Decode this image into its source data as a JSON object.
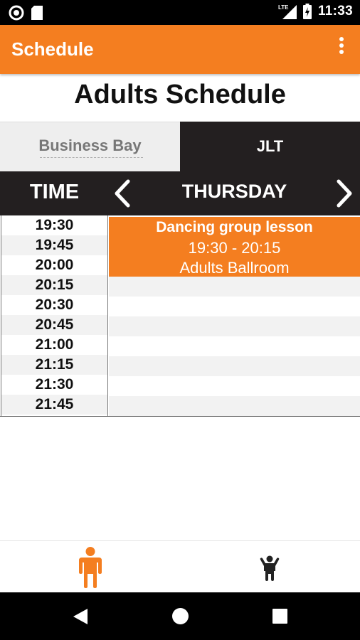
{
  "status_bar": {
    "time": "11:33",
    "network": "LTE",
    "icons": [
      "circle-notification-icon",
      "sd-card-icon",
      "signal-icon",
      "battery-charging-icon"
    ]
  },
  "app_bar": {
    "title": "Schedule",
    "menu_icon": "more-vert-icon",
    "color": "#f47e20"
  },
  "page_title": "Adults Schedule",
  "location_tabs": [
    {
      "label": "Business Bay",
      "selected": false
    },
    {
      "label": "JLT",
      "selected": true
    }
  ],
  "schedule_header": {
    "time_label": "TIME",
    "day": "THURSDAY",
    "prev_icon": "chevron-left-icon",
    "next_icon": "chevron-right-icon"
  },
  "time_slots": [
    "19:30",
    "19:45",
    "20:00",
    "20:15",
    "20:30",
    "20:45",
    "21:00",
    "21:15",
    "21:30",
    "21:45"
  ],
  "events": [
    {
      "name": "Dancing group lesson",
      "time": "19:30 - 20:15",
      "room": "Adults Ballroom"
    }
  ],
  "bottom_nav": [
    {
      "icon": "adult-person-icon",
      "active": true,
      "color": "#f47e20"
    },
    {
      "icon": "child-person-icon",
      "active": false,
      "color": "#222222"
    }
  ],
  "system_nav": [
    "back-icon",
    "home-icon",
    "recents-icon"
  ]
}
